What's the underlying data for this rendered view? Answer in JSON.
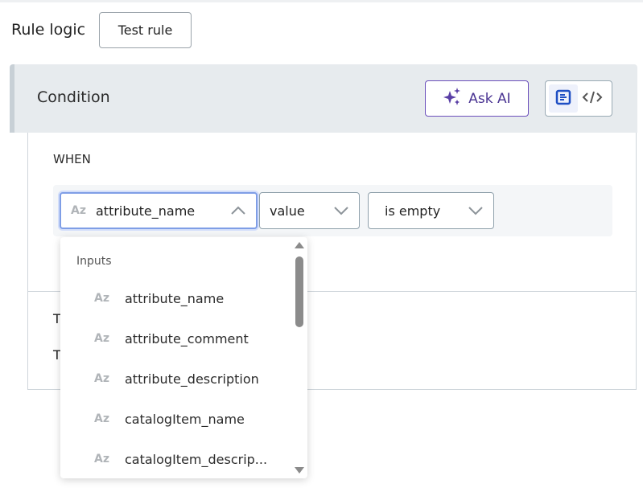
{
  "header": {
    "title": "Rule logic",
    "test_rule": "Test rule"
  },
  "condition": {
    "title": "Condition",
    "ask_ai": "Ask AI",
    "when": "WHEN",
    "selects": {
      "field": "attribute_name",
      "property": "value",
      "operator": "is empty"
    },
    "type_badge": "Az",
    "then_labels": [
      "T",
      "T"
    ]
  },
  "dropdown": {
    "group": "Inputs",
    "options": [
      {
        "type": "Az",
        "label": "attribute_name"
      },
      {
        "type": "Az",
        "label": "attribute_comment"
      },
      {
        "type": "Az",
        "label": "attribute_description"
      },
      {
        "type": "Az",
        "label": "catalogItem_name"
      },
      {
        "type": "Az",
        "label": "catalogItem_descrip..."
      }
    ]
  },
  "colors": {
    "accent_ai": "#6b4fbb",
    "focus": "#7f9ee6",
    "view_icon": "#1f4fc4"
  }
}
